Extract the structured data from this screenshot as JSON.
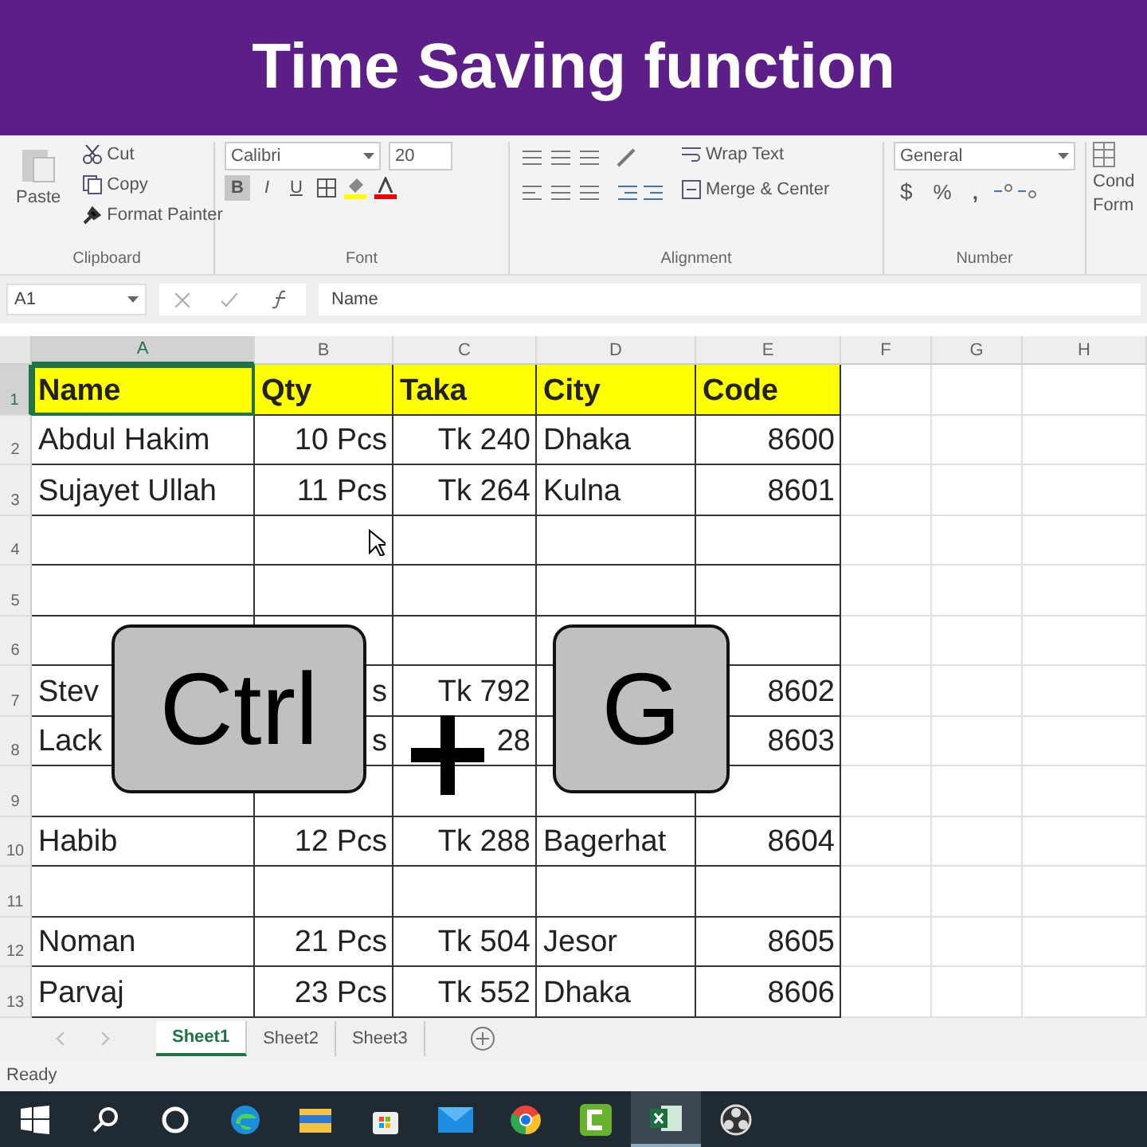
{
  "banner": {
    "title": "Time Saving function"
  },
  "ribbon": {
    "clipboard": {
      "paste": "Paste",
      "cut": "Cut",
      "copy": "Copy",
      "format_painter": "Format Painter",
      "label": "Clipboard"
    },
    "font": {
      "name": "Calibri",
      "size": "20",
      "bold": "B",
      "italic": "I",
      "underline": "U",
      "label": "Font"
    },
    "alignment": {
      "wrap": "Wrap Text",
      "merge": "Merge & Center",
      "label": "Alignment"
    },
    "number": {
      "format": "General",
      "currency": "$",
      "percent": "%",
      "comma": ",",
      "label": "Number"
    },
    "styles": {
      "conditional": "Cond",
      "conditional_2": "Form"
    }
  },
  "formula_bar": {
    "name_box": "A1",
    "value": "Name"
  },
  "sheet": {
    "columns": [
      {
        "label": "A",
        "kind": "text",
        "selected": true
      },
      {
        "label": "B",
        "kind": "number",
        "selected": false
      },
      {
        "label": "C",
        "kind": "number",
        "selected": false
      },
      {
        "label": "D",
        "kind": "text",
        "selected": false
      },
      {
        "label": "E",
        "kind": "number",
        "selected": false
      },
      {
        "label": "F",
        "kind": "text",
        "selected": false
      },
      {
        "label": "G",
        "kind": "text",
        "selected": false
      },
      {
        "label": "H",
        "kind": "text",
        "selected": false
      }
    ],
    "rows": [
      {
        "number": "1",
        "selected": true,
        "highlighted": true,
        "cells": [
          "Name",
          "Qty",
          "Taka",
          "City",
          "Code"
        ]
      },
      {
        "number": "2",
        "selected": false,
        "highlighted": false,
        "cells": [
          "Abdul Hakim",
          "10 Pcs",
          "Tk 240",
          "Dhaka",
          "8600"
        ]
      },
      {
        "number": "3",
        "selected": false,
        "highlighted": false,
        "cells": [
          "Sujayet Ullah",
          "11 Pcs",
          "Tk 264",
          "Kulna",
          "8601"
        ]
      },
      {
        "number": "4",
        "selected": false,
        "highlighted": false,
        "cells": []
      },
      {
        "number": "5",
        "selected": false,
        "highlighted": false,
        "cells": []
      },
      {
        "number": "6",
        "selected": false,
        "highlighted": false,
        "cells": []
      },
      {
        "number": "7",
        "selected": false,
        "highlighted": false,
        "cells": [
          "Stev",
          "s",
          "Tk 792",
          null,
          "8602"
        ]
      },
      {
        "number": "8",
        "selected": false,
        "highlighted": false,
        "cells": [
          "Lack",
          "s",
          "28",
          null,
          "8603"
        ]
      },
      {
        "number": "9",
        "selected": false,
        "highlighted": false,
        "cells": []
      },
      {
        "number": "10",
        "selected": false,
        "highlighted": false,
        "cells": [
          "Habib",
          "12 Pcs",
          "Tk 288",
          "Bagerhat",
          "8604"
        ]
      },
      {
        "number": "11",
        "selected": false,
        "highlighted": false,
        "cells": []
      },
      {
        "number": "12",
        "selected": false,
        "highlighted": false,
        "cells": [
          "Noman",
          "21 Pcs",
          "Tk 504",
          "Jesor",
          "8605"
        ]
      },
      {
        "number": "13",
        "selected": false,
        "highlighted": false,
        "cells": [
          "Parvaj",
          "23 Pcs",
          "Tk 552",
          "Dhaka",
          "8606"
        ]
      }
    ]
  },
  "shortcut": {
    "keys": [
      "Ctrl",
      "G"
    ]
  },
  "sheet_tabs": [
    {
      "label": "Sheet1",
      "selected": true
    },
    {
      "label": "Sheet2",
      "selected": false
    },
    {
      "label": "Sheet3",
      "selected": false
    }
  ],
  "status_bar": {
    "text": "Ready"
  },
  "taskbar": {
    "apps": [
      {
        "kind": "start"
      },
      {
        "kind": "search"
      },
      {
        "kind": "cortana"
      },
      {
        "kind": "edge"
      },
      {
        "kind": "files"
      },
      {
        "kind": "store"
      },
      {
        "kind": "mail"
      },
      {
        "kind": "chrome"
      },
      {
        "kind": "camtasia"
      },
      {
        "kind": "excel",
        "selected": true
      },
      {
        "kind": "obs"
      }
    ]
  }
}
